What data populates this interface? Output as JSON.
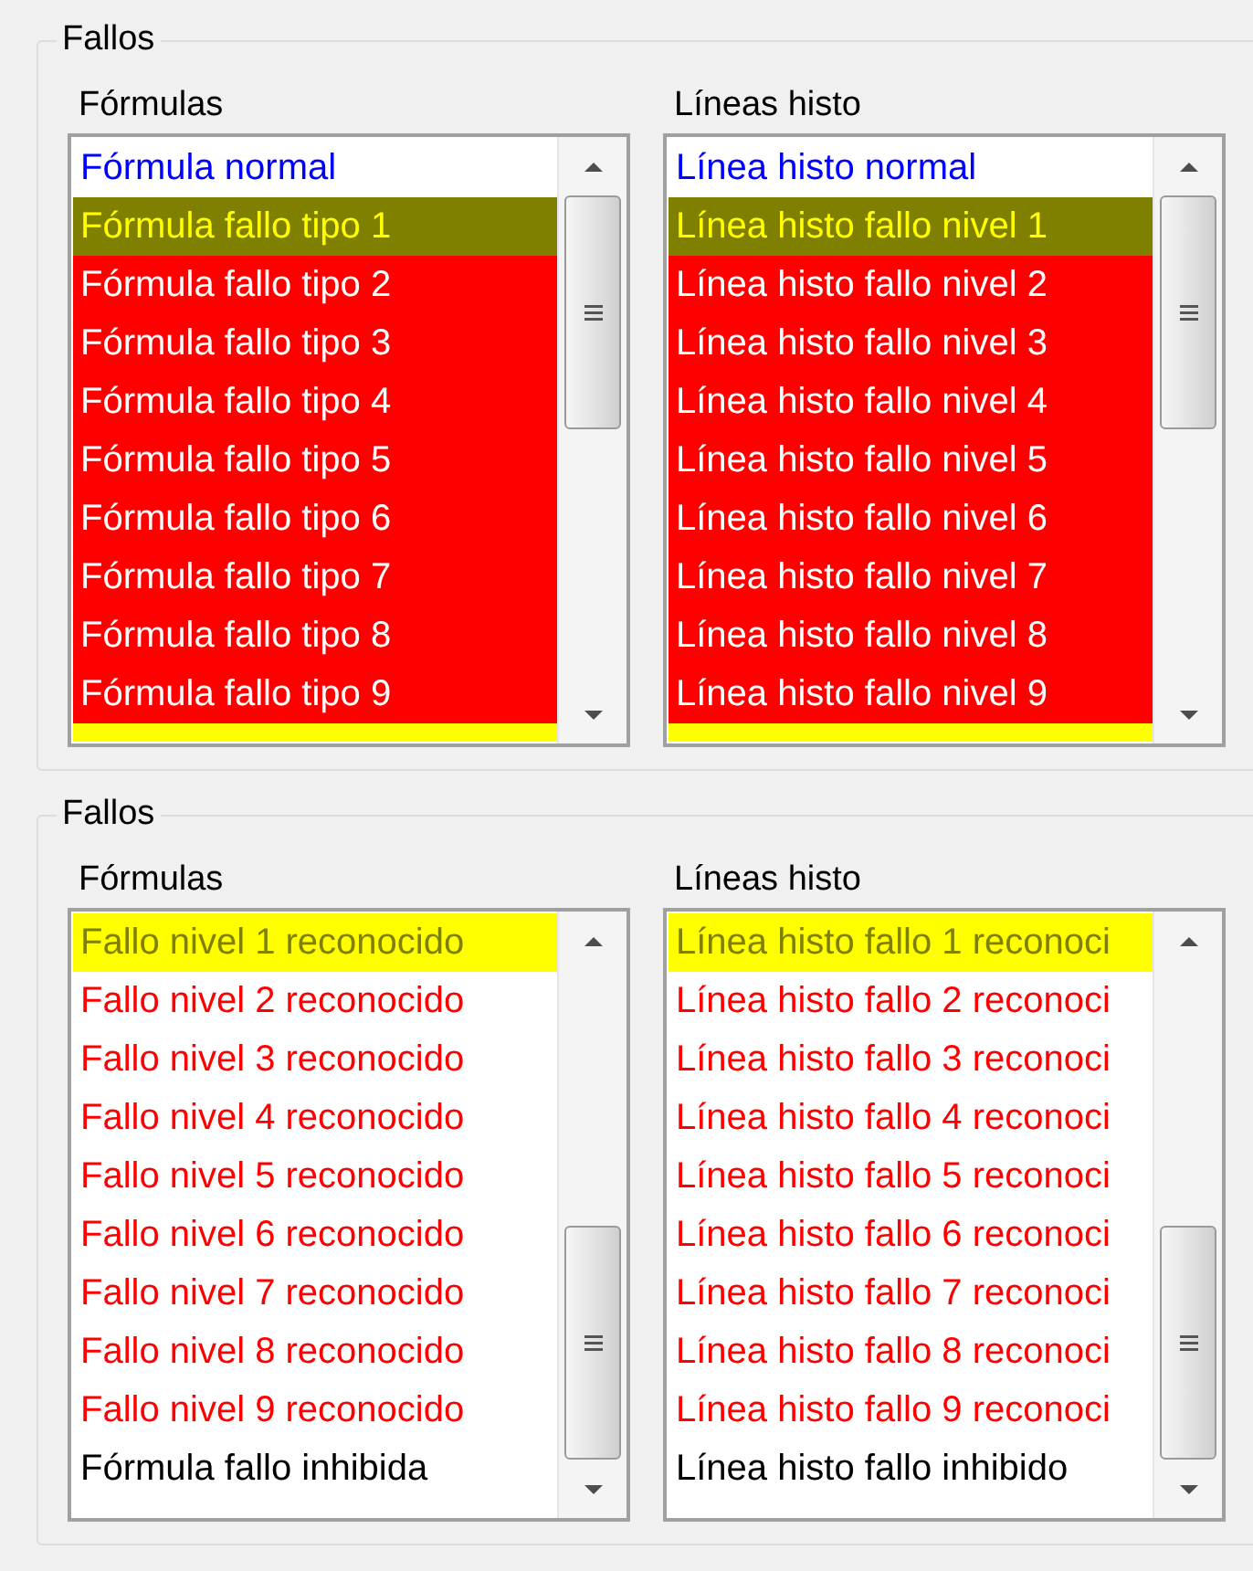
{
  "groups": [
    {
      "title": "Fallos",
      "lists": [
        {
          "label": "Fórmulas",
          "kind": "scrolled_top",
          "items": [
            {
              "text": "Fórmula normal",
              "kind": "normal"
            },
            {
              "text": "Fórmula fallo tipo 1",
              "kind": "level1"
            },
            {
              "text": "Fórmula fallo tipo 2",
              "kind": "fault"
            },
            {
              "text": "Fórmula fallo tipo 3",
              "kind": "fault"
            },
            {
              "text": "Fórmula fallo tipo 4",
              "kind": "fault"
            },
            {
              "text": "Fórmula fallo tipo 5",
              "kind": "fault"
            },
            {
              "text": "Fórmula fallo tipo 6",
              "kind": "fault"
            },
            {
              "text": "Fórmula fallo tipo 7",
              "kind": "fault"
            },
            {
              "text": "Fórmula fallo tipo 8",
              "kind": "fault"
            },
            {
              "text": "Fórmula fallo tipo 9",
              "kind": "fault"
            },
            {
              "kind": "ack1"
            }
          ]
        },
        {
          "label": "Líneas histo",
          "kind": "scrolled_top",
          "items": [
            {
              "text": "Línea histo normal",
              "kind": "normal"
            },
            {
              "text": "Línea histo fallo nivel 1",
              "kind": "level1"
            },
            {
              "text": "Línea histo fallo nivel 2",
              "kind": "fault"
            },
            {
              "text": "Línea histo fallo nivel 3",
              "kind": "fault"
            },
            {
              "text": "Línea histo fallo nivel 4",
              "kind": "fault"
            },
            {
              "text": "Línea histo fallo nivel 5",
              "kind": "fault"
            },
            {
              "text": "Línea histo fallo nivel 6",
              "kind": "fault"
            },
            {
              "text": "Línea histo fallo nivel 7",
              "kind": "fault"
            },
            {
              "text": "Línea histo fallo nivel 8",
              "kind": "fault"
            },
            {
              "text": "Línea histo fallo nivel 9",
              "kind": "fault"
            },
            {
              "kind": "ack1"
            }
          ]
        }
      ]
    },
    {
      "title": "Fallos",
      "lists": [
        {
          "label": "Fórmulas",
          "kind": "scrolled_bottom",
          "items": [
            {
              "text": "Fallo nivel 1 reconocido",
              "kind": "ack1"
            },
            {
              "text": "Fallo nivel 2 reconocido",
              "kind": "ack"
            },
            {
              "text": "Fallo nivel 3 reconocido",
              "kind": "ack"
            },
            {
              "text": "Fallo nivel 4 reconocido",
              "kind": "ack"
            },
            {
              "text": "Fallo nivel 5 reconocido",
              "kind": "ack"
            },
            {
              "text": "Fallo nivel 6 reconocido",
              "kind": "ack"
            },
            {
              "text": "Fallo nivel 7 reconocido",
              "kind": "ack"
            },
            {
              "text": "Fallo nivel 8 reconocido",
              "kind": "ack"
            },
            {
              "text": "Fallo nivel 9 reconocido",
              "kind": "ack"
            },
            {
              "text": "Fórmula fallo inhibida",
              "kind": "inhibited"
            }
          ]
        },
        {
          "label": "Líneas histo",
          "kind": "scrolled_bottom",
          "items": [
            {
              "text": "Línea histo fallo 1 reconoci",
              "kind": "ack1"
            },
            {
              "text": "Línea histo fallo 2 reconoci",
              "kind": "ack"
            },
            {
              "text": "Línea histo fallo 3 reconoci",
              "kind": "ack"
            },
            {
              "text": "Línea histo fallo 4 reconoci",
              "kind": "ack"
            },
            {
              "text": "Línea histo fallo 5 reconoci",
              "kind": "ack"
            },
            {
              "text": "Línea histo fallo 6 reconoci",
              "kind": "ack"
            },
            {
              "text": "Línea histo fallo 7 reconoci",
              "kind": "ack"
            },
            {
              "text": "Línea histo fallo 8 reconoci",
              "kind": "ack"
            },
            {
              "text": "Línea histo fallo 9 reconoci",
              "kind": "ack"
            },
            {
              "text": "Línea histo fallo inhibido",
              "kind": "inhibited"
            }
          ]
        }
      ]
    }
  ]
}
